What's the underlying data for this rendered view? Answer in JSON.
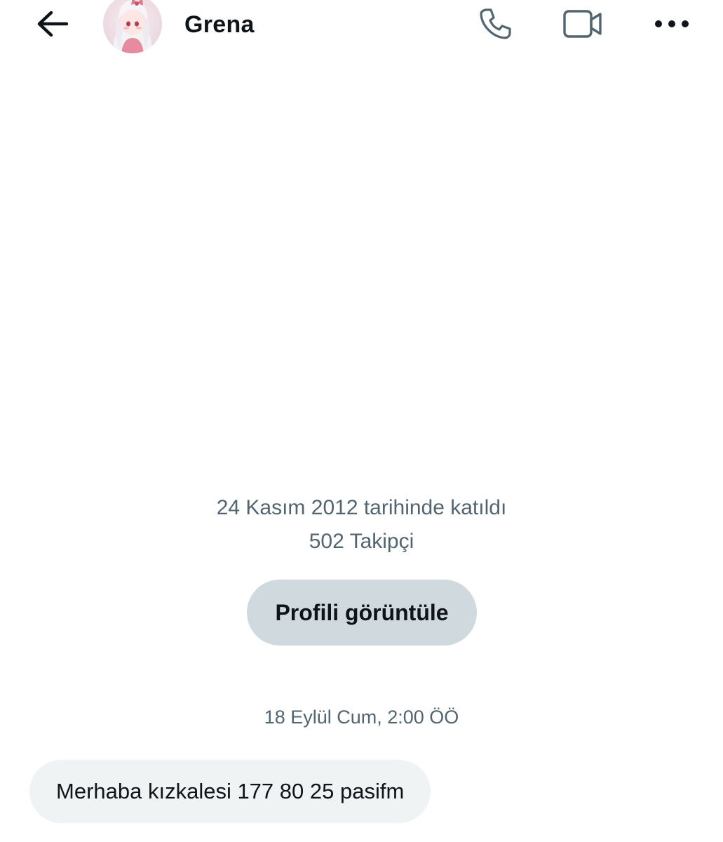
{
  "header": {
    "back_icon": "arrow-left-icon",
    "contact_name": "Grena",
    "actions": {
      "call_icon": "phone-icon",
      "video_icon": "video-camera-icon",
      "more_icon": "more-horizontal-icon"
    }
  },
  "profile": {
    "joined": "24 Kasım 2012 tarihinde katıldı",
    "followers": "502 Takipçi",
    "view_profile_label": "Profili görüntüle"
  },
  "conversation": {
    "timestamp": "18 Eylül Cum, 2:00 ÖÖ",
    "messages": [
      {
        "text": "Merhaba kızkalesi 177 80 25 pasifm"
      }
    ]
  },
  "colors": {
    "text_primary": "#0f1419",
    "text_secondary": "#536471",
    "button_bg": "#cfd9de",
    "bubble_bg": "#eff3f4"
  }
}
